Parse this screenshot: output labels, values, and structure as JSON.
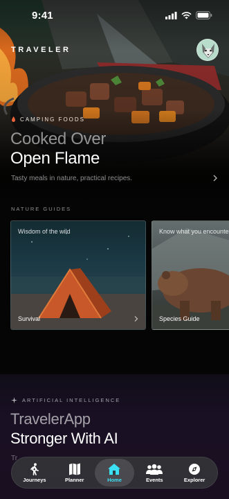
{
  "status_bar": {
    "time": "9:41"
  },
  "brand": "TRAVELER",
  "hero": {
    "tag": "CAMPING FOODS",
    "title_line1": "Cooked Over",
    "title_line2": "Open Flame",
    "subtitle": "Tasty meals in nature, practical recipes."
  },
  "guides": {
    "section_label": "NATURE GUIDES",
    "cards": [
      {
        "top_text": "Wisdom of the wild",
        "bottom_text": "Survival"
      },
      {
        "top_text": "Know what you encounter",
        "bottom_text": "Species Guide"
      }
    ]
  },
  "ai": {
    "tag": "ARTIFICIAL INTELLIGENCE",
    "title_line1": "TravelerApp",
    "title_line2": "Stronger With AI",
    "subtitle": "Tr"
  },
  "tabbar": {
    "active_color": "#3be0f5",
    "tabs": [
      {
        "label": "Journeys",
        "icon": "hiker-icon",
        "active": false
      },
      {
        "label": "Planner",
        "icon": "map-icon",
        "active": false
      },
      {
        "label": "Home",
        "icon": "home-icon",
        "active": true
      },
      {
        "label": "Events",
        "icon": "people-icon",
        "active": false
      },
      {
        "label": "Explorer",
        "icon": "compass-icon",
        "active": false
      }
    ]
  }
}
